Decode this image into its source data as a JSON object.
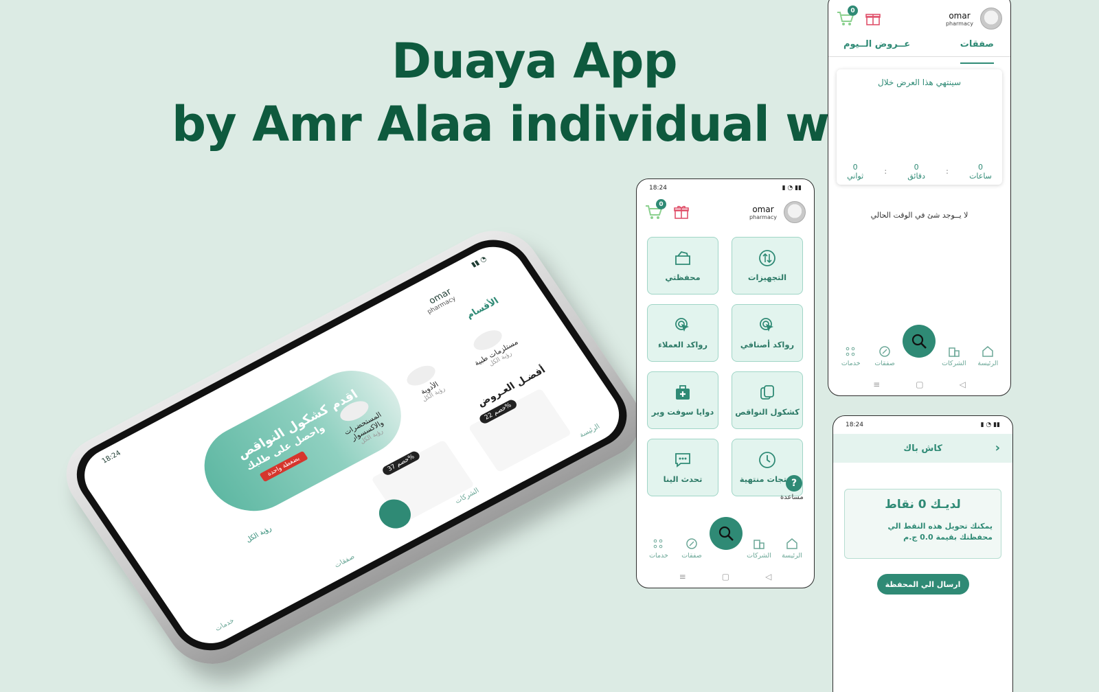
{
  "headline": {
    "line1": "Duaya App",
    "line2": "by Amr Alaa  individual work"
  },
  "colors": {
    "brand": "#2f8a75",
    "headline": "#0e5a3e",
    "tile_bg": "#e2f4ee",
    "background": "#dcebe4"
  },
  "status_bar": {
    "time": "18:24"
  },
  "app_bar": {
    "cart_count": "0",
    "user_name": "omar",
    "user_role": "pharmacy"
  },
  "grid_screen": {
    "tiles": [
      {
        "label": "التجهيزات",
        "icon": "transfer-icon"
      },
      {
        "label": "محفظتي",
        "icon": "wallet-icon"
      },
      {
        "label": "رواكد أصنافي",
        "icon": "cursor-click-icon"
      },
      {
        "label": "رواكد العملاء",
        "icon": "cursor-click-icon"
      },
      {
        "label": "كشكول النواقص",
        "icon": "notebook-icon"
      },
      {
        "label": "دوايا سوفت وير",
        "icon": "medkit-icon"
      },
      {
        "label": "منتجات منتهية",
        "icon": "clock-icon"
      },
      {
        "label": "تحدث الينا",
        "icon": "chat-icon"
      }
    ],
    "help_label": "مساعدة"
  },
  "bottom_nav": {
    "home": "الرئيسة",
    "companies": "الشركات",
    "search": "بحث",
    "deals": "صفقات",
    "services": "خدمات"
  },
  "deals_screen": {
    "tab_deals": "صفقات",
    "tab_today": "عــروض الــيوم",
    "offer_title": "سينتهي هذا العرض خلال",
    "countdown": [
      {
        "value": "0",
        "unit": "ساعات"
      },
      {
        "value": "0",
        "unit": "دقائق"
      },
      {
        "value": "0",
        "unit": "ثواني"
      }
    ],
    "empty_message": "لا يــوجد شئ في الوقت الحالي"
  },
  "cashback_screen": {
    "title": "كاش باك",
    "points_title": "لديـك 0 نقاط",
    "points_desc": "يمكنك تحويل هذه النقط الي محفظتك بقيمة 0.0 ج.م",
    "send_button": "ارسال الي المحفظة"
  },
  "home_phone": {
    "user_name": "omar",
    "user_role": "pharmacy",
    "banner_text": "اقدم كشكول النواقص",
    "banner_sub": "واحصل على طلبك",
    "banner_chip": "بضغطة واحدة",
    "sections_title": "الأقسام",
    "categories": [
      {
        "label": "مستلزمات طبية",
        "sub": "رؤية الكل"
      },
      {
        "label": "الأدوية",
        "sub": "رؤية الكل"
      },
      {
        "label": "المستحضرات والاكسسوار",
        "sub": "رؤية الكل"
      }
    ],
    "view_all": "رؤية الكل",
    "best_offers": "أفضـل العـروض",
    "deals": [
      {
        "badge": "خصم 22%"
      },
      {
        "badge": "خصم 37%"
      }
    ]
  }
}
